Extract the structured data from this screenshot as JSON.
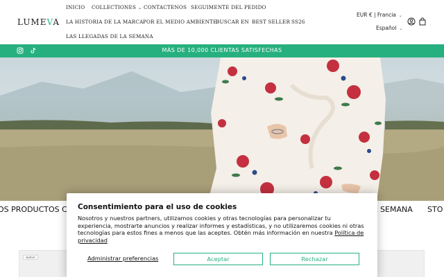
{
  "header": {
    "logo": {
      "part1": "LUME",
      "part2": "V",
      "part3": "A"
    },
    "nav": [
      {
        "label": "INICIO"
      },
      {
        "label": "COLLECTIONES",
        "has_caret": true
      },
      {
        "label": "CONTACTENOS"
      },
      {
        "label": "SEGUIMENTE DEL PEDIDO"
      },
      {
        "label": "LA HISTORIA DE LA MARCA"
      },
      {
        "label": "POR EL MEDIO AMBIENTE"
      },
      {
        "label": "BUSCAR EN"
      },
      {
        "label": "BEST SELLER"
      },
      {
        "label": "SS26"
      },
      {
        "label": "LAS LLEGADAS DE LA SEMANA"
      }
    ],
    "currency": "EUR € | Francia",
    "language": "Español",
    "caret": "⌄",
    "icons": [
      "account-icon",
      "cart-icon"
    ]
  },
  "announcement": {
    "message": "MÁS DE 10,000 CLIENTAS SATISFECHAS",
    "icons": [
      "instagram-icon",
      "tiktok-icon"
    ]
  },
  "marquee": {
    "left_text": "OS PRODUCTOS CA",
    "right_text": "A SEMANA",
    "far_right_text": "STO"
  },
  "product_badge": "NUEVO",
  "cookie_banner": {
    "title": "Consentimiento para el uso de cookies",
    "body": "Nosotros y nuestros partners, utilizamos cookies y otras tecnologías para personalizar tu experiencia, mostrarte anuncios y realizar informes y estadísticas, y no utilizaremos cookies ni otras tecnologías para estos fines a menos que las aceptes. Obtén más información en nuestra",
    "privacy_link": "Política de privacidad",
    "manage_label": "Administrar preferencias",
    "accept_label": "Aceptar",
    "reject_label": "Rechazar"
  },
  "colors": {
    "brand_green": "#27b07f",
    "logo_accent": "#1fb38a",
    "text": "#1a1a1a"
  }
}
